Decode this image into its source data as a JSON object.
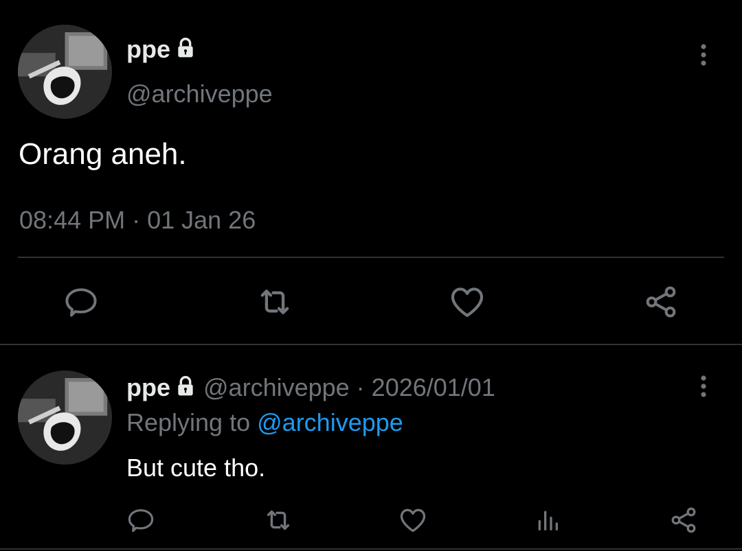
{
  "main_tweet": {
    "display_name": "ppe",
    "handle": "@archiveppe",
    "text": "Orang aneh.",
    "timestamp": "08:44 PM · 01 Jan 26",
    "actions": [
      "reply-icon",
      "retweet-icon",
      "like-icon",
      "share-icon"
    ]
  },
  "reply_tweet": {
    "display_name": "ppe",
    "meta": "@archiveppe · 2026/01/01",
    "replying_prefix": "Replying to",
    "replying_mention": "@archiveppe",
    "text": "But cute tho.",
    "actions": [
      "reply-icon",
      "retweet-icon",
      "like-icon",
      "analytics-icon",
      "share-icon"
    ]
  },
  "colors": {
    "background": "#000000",
    "primary_text": "#e7e9ea",
    "secondary_text": "#71767b",
    "accent": "#1d9bf0",
    "divider": "#2f3336"
  }
}
